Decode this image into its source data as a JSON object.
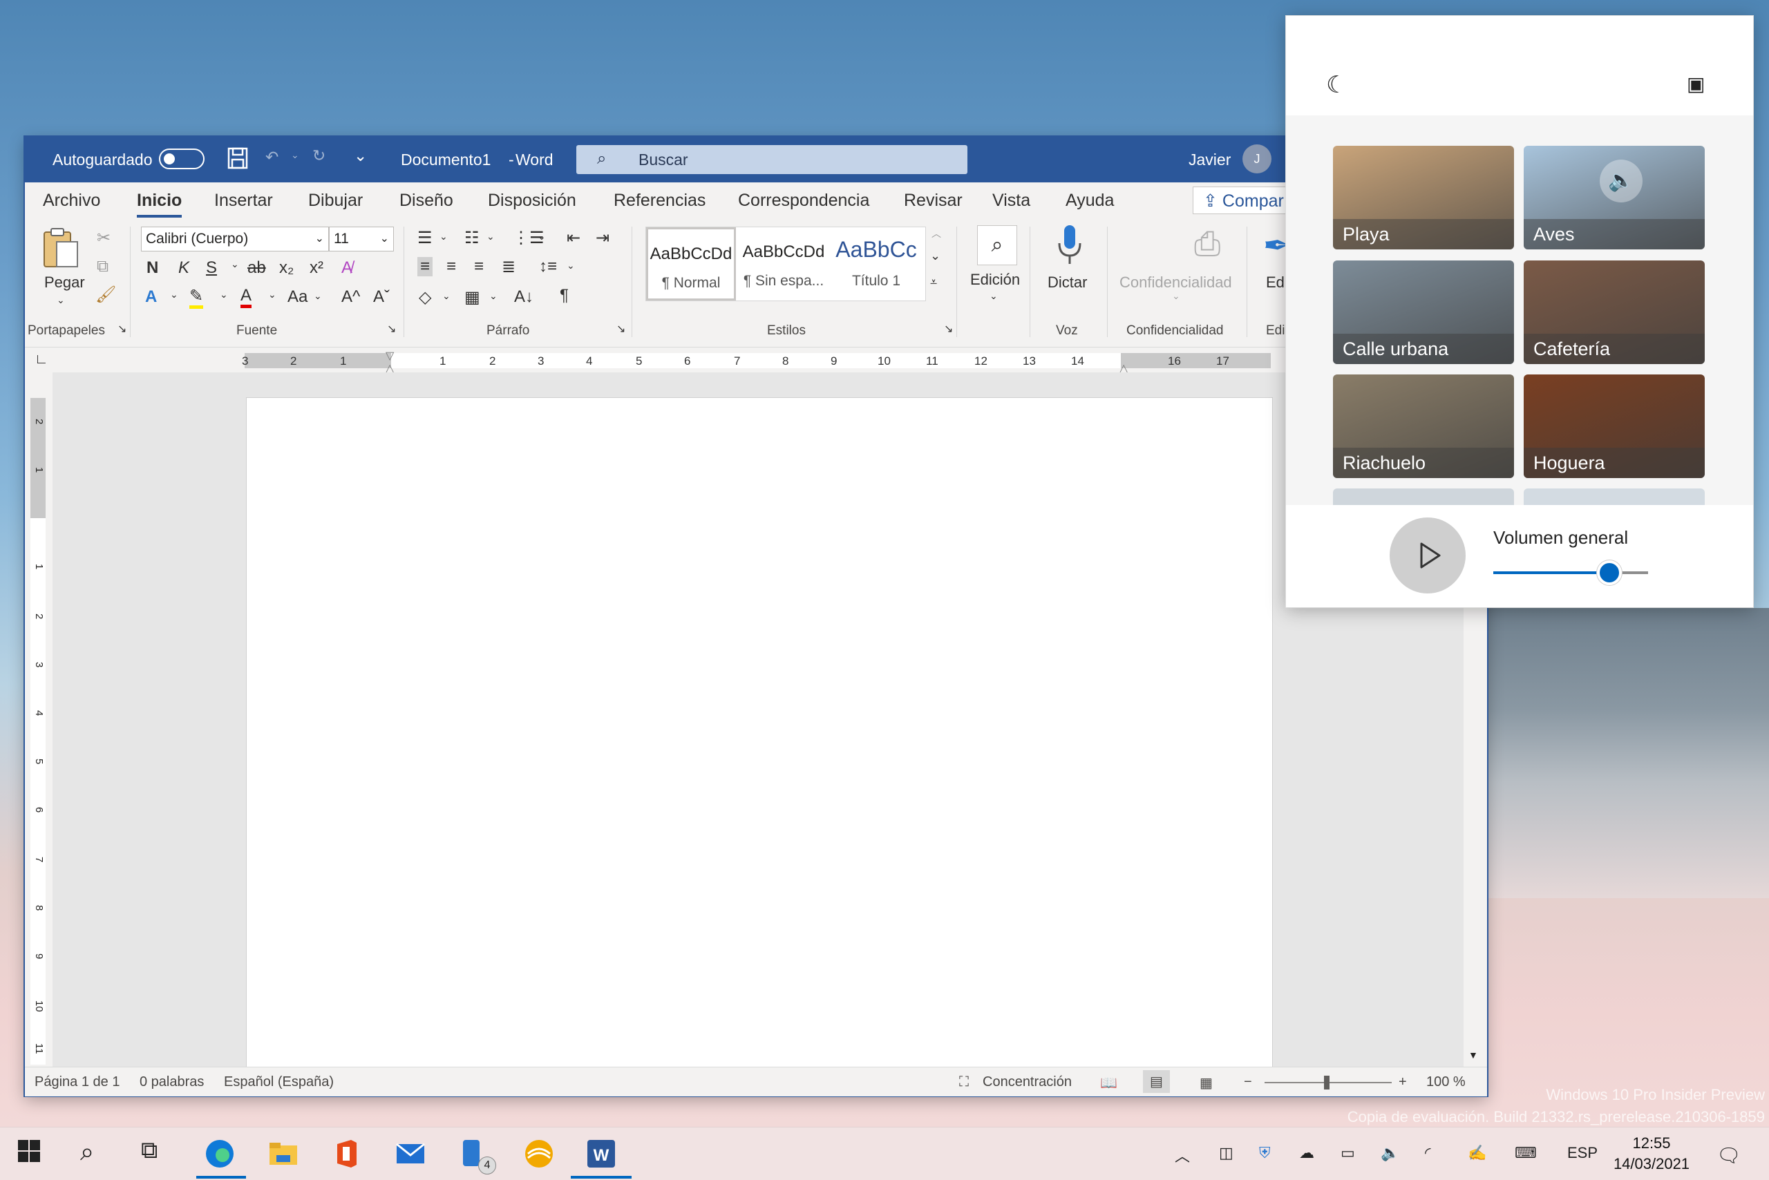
{
  "desktop": {
    "watermark_line1": "Windows 10 Pro Insider Preview",
    "watermark_line2": "Copia de evaluación. Build 21332.rs_prerelease.210306-1859"
  },
  "word": {
    "autosave_label": "Autoguardado",
    "doc_title": "Documento1",
    "title_sep": "-",
    "app_name": "Word",
    "search_placeholder": "Buscar",
    "user_name": "Javier",
    "user_initial": "J",
    "menu": [
      "Archivo",
      "Inicio",
      "Insertar",
      "Dibujar",
      "Diseño",
      "Disposición",
      "Referencias",
      "Correspondencia",
      "Revisar",
      "Vista",
      "Ayuda"
    ],
    "active_menu": "Inicio",
    "share_label": "Compar",
    "clipboard": {
      "paste_label": "Pegar",
      "group": "Portapapeles"
    },
    "font": {
      "name": "Calibri (Cuerpo)",
      "size": "11",
      "group": "Fuente",
      "bold": "N",
      "italic": "K",
      "underline": "S",
      "strike": "ab",
      "sub": "x₂",
      "sup": "x²",
      "case": "Aa",
      "grow": "A^",
      "shrink": "Aˇ"
    },
    "paragraph": {
      "group": "Párrafo",
      "pilcrow": "¶"
    },
    "styles": {
      "group": "Estilos",
      "items": [
        {
          "sample": "AaBbCcDd",
          "name": "¶ Normal"
        },
        {
          "sample": "AaBbCcDd",
          "name": "¶ Sin espa..."
        },
        {
          "sample": "AaBbCc",
          "name": "Título 1"
        }
      ]
    },
    "editing_label": "Edición",
    "dictate_label": "Dictar",
    "voice_group": "Voz",
    "confidential_label": "Confidencialidad",
    "confidential_group": "Confidencialidad",
    "editor_label": "Edi",
    "editor_group": "Edi",
    "ruler_numbers": [
      "3",
      "2",
      "1",
      "1",
      "2",
      "3",
      "4",
      "5",
      "6",
      "7",
      "8",
      "9",
      "10",
      "11",
      "12",
      "13",
      "14",
      "16",
      "17"
    ],
    "vruler_numbers": [
      "2",
      "1",
      "1",
      "2",
      "3",
      "4",
      "5",
      "6",
      "7",
      "8",
      "9",
      "10",
      "11"
    ],
    "status": {
      "page": "Página 1 de 1",
      "words": "0 palabras",
      "language": "Español (España)",
      "focus": "Concentración",
      "zoom_minus": "−",
      "zoom_plus": "+",
      "zoom": "100 %"
    }
  },
  "focus_panel": {
    "sounds": [
      {
        "label": "Playa",
        "color": "#c9a47a"
      },
      {
        "label": "Aves",
        "color": "#a8c4dc"
      },
      {
        "label": "Calle urbana",
        "color": "#7d8c98"
      },
      {
        "label": "Cafetería",
        "color": "#7b5a47"
      },
      {
        "label": "Riachuelo",
        "color": "#8a7d68"
      },
      {
        "label": "Hoguera",
        "color": "#7a3f22"
      }
    ],
    "volume_label": "Volumen general",
    "volume_level": 0.75
  },
  "taskbar": {
    "icons": [
      "start-icon",
      "search-icon",
      "task-view-icon",
      "edge-icon",
      "file-explorer-icon",
      "office-icon",
      "mail-icon",
      "phone-icon",
      "browser-icon",
      "word-icon"
    ],
    "phone_badge": "4",
    "language": "ESP",
    "time": "12:55",
    "date": "14/03/2021"
  },
  "colors": {
    "word_blue": "#2b579a",
    "accent": "#0067c0"
  }
}
